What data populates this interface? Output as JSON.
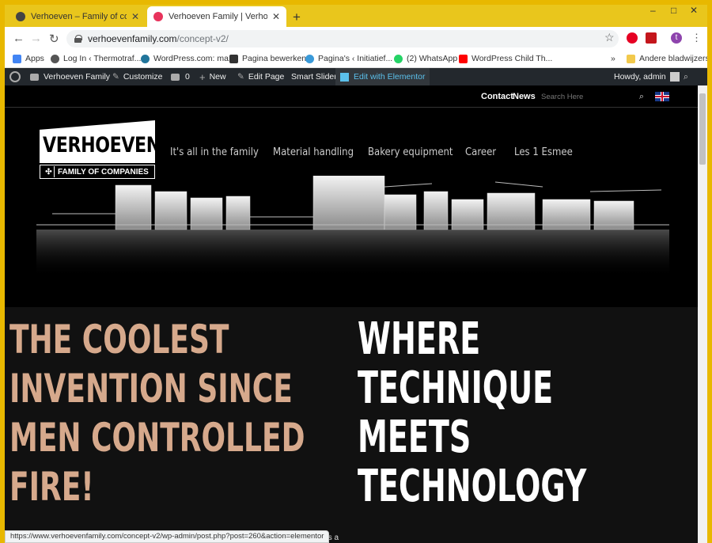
{
  "browser": {
    "tabs": [
      {
        "title": "Verhoeven – Family of compagnies",
        "active": false
      },
      {
        "title": "Verhoeven Family | Verhoeven Fami",
        "active": true
      }
    ],
    "new_tab_label": "+",
    "window_controls": [
      "–",
      "□",
      "✕"
    ],
    "url_host": "verhoevenfamily.com",
    "url_path": "/concept-v2/",
    "profile_initial": "t"
  },
  "bookmarks": {
    "items": [
      {
        "label": "Apps",
        "icon": "apps-grid-icon",
        "color": "#4285f4"
      },
      {
        "label": "Log In ‹ Thermotraf...",
        "icon": "globe-icon",
        "color": "#555555"
      },
      {
        "label": "WordPress.com: ma...",
        "icon": "wordpress-icon",
        "color": "#21759b"
      },
      {
        "label": "Pagina bewerken",
        "icon": "gear-icon",
        "color": "#333333"
      },
      {
        "label": "Pagina's ‹ Initiatief...",
        "icon": "cloud-icon",
        "color": "#3a9ad9"
      },
      {
        "label": "(2) WhatsApp",
        "icon": "whatsapp-icon",
        "color": "#25d366"
      },
      {
        "label": "WordPress Child Th...",
        "icon": "youtube-icon",
        "color": "#ff0000"
      }
    ],
    "overflow": "»",
    "other_folder": "Andere bladwijzers"
  },
  "adminbar": {
    "site_name": "Verhoeven Family",
    "customize": "Customize",
    "comments_count": "0",
    "new": "New",
    "edit_page": "Edit Page",
    "smart_slider": "Smart Slider",
    "edit_elementor": "Edit with Elementor",
    "howdy": "Howdy, admin"
  },
  "site": {
    "top_links": {
      "contact": "Contact",
      "news": "News"
    },
    "search_placeholder": "Search Here",
    "logo": {
      "name": "VERHOEVEN",
      "subtitle": "FAMILY OF COMPANIES"
    },
    "menu": [
      "It's all in the family",
      "Material handling",
      "Bakery equipment",
      "Career",
      "Les 1 Esmee"
    ],
    "headline_left": [
      "THE COOLEST",
      "INVENTION SINCE",
      "MEN CONTROLLED",
      "FIRE!"
    ],
    "headline_right": [
      "WHERE",
      "TECHNIQUE",
      "MEETS",
      "TECHNOLOGY"
    ],
    "tail_text": "is was a",
    "accent_color": "#d6a98c"
  },
  "status_url": "https://www.verhoevenfamily.com/concept-v2/wp-admin/post.php?post=260&action=elementor"
}
